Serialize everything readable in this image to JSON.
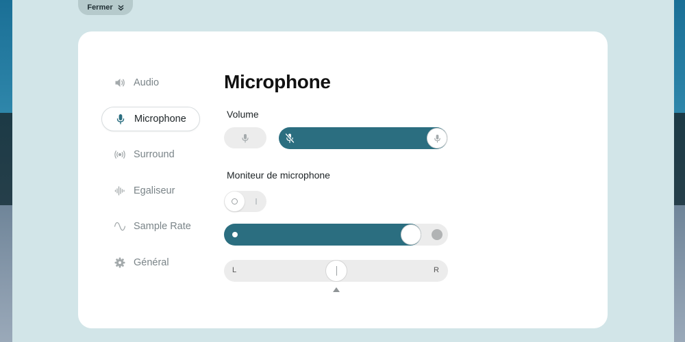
{
  "close_button": {
    "label": "Fermer",
    "icon": "chevron-double-down-icon"
  },
  "sidebar": {
    "items": [
      {
        "label": "Audio",
        "icon": "speaker-icon",
        "active": false
      },
      {
        "label": "Microphone",
        "icon": "microphone-icon",
        "active": true
      },
      {
        "label": "Surround",
        "icon": "surround-icon",
        "active": false
      },
      {
        "label": "Egaliseur",
        "icon": "equalizer-icon",
        "active": false
      },
      {
        "label": "Sample Rate",
        "icon": "sine-wave-icon",
        "active": false
      },
      {
        "label": "Général",
        "icon": "gear-icon",
        "active": false
      }
    ]
  },
  "main": {
    "title": "Microphone",
    "volume": {
      "label": "Volume",
      "level_percent": 100
    },
    "monitor": {
      "label": "Moniteur de microphone",
      "enabled": false,
      "level_percent": 87,
      "balance": {
        "left_label": "L",
        "right_label": "R",
        "value": 0
      }
    }
  },
  "colors": {
    "accent": "#2b6e80",
    "track": "#ececec",
    "background": "#d2e5e8",
    "card": "#ffffff"
  }
}
